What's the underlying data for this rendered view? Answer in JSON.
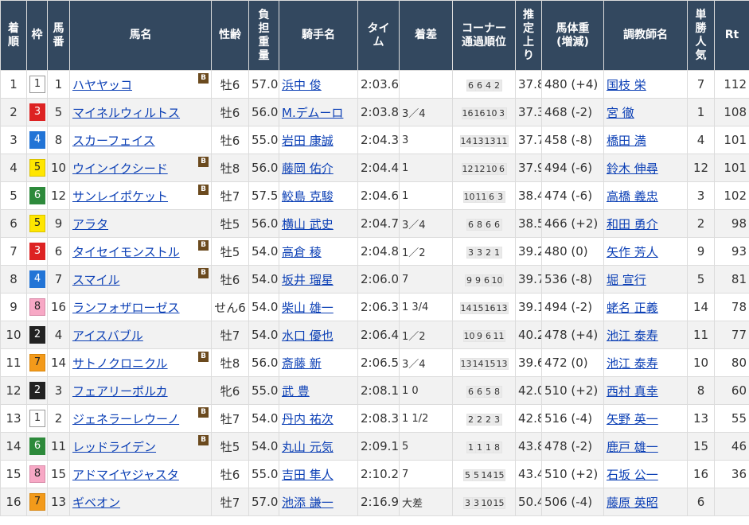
{
  "headers": [
    "着\n順",
    "枠",
    "馬\n番",
    "馬名",
    "性齢",
    "負\n担\n重\n量",
    "騎手名",
    "タイ\nム",
    "着差",
    "コーナー\n通過順位",
    "推\n定\n上\nり",
    "馬体重\n(増減)",
    "調教師名",
    "単\n勝\n人\n気",
    "Rt"
  ],
  "blinker_label": "B",
  "rows": [
    {
      "rank": "1",
      "waku": "1",
      "ban": "1",
      "horse": "ハヤヤッコ",
      "b": true,
      "sex_age": "牡6",
      "weight": "57.0",
      "jockey": "浜中 俊",
      "time": "2:03.6",
      "margin": "",
      "corners": [
        "6",
        "6",
        "4",
        "2"
      ],
      "last3f": "37.8",
      "body": "480 (+4)",
      "trainer": "国枝 栄",
      "pop": "7",
      "rt": "112"
    },
    {
      "rank": "2",
      "waku": "3",
      "ban": "5",
      "horse": "マイネルウィルトス",
      "b": false,
      "sex_age": "牡6",
      "weight": "56.0",
      "jockey": "M.デムーロ",
      "time": "2:03.8",
      "margin": "3／4",
      "corners": [
        "16",
        "16",
        "10",
        "3"
      ],
      "last3f": "37.3",
      "body": "468 (-2)",
      "trainer": "宮 徹",
      "pop": "1",
      "rt": "108"
    },
    {
      "rank": "3",
      "waku": "4",
      "ban": "8",
      "horse": "スカーフェイス",
      "b": false,
      "sex_age": "牡6",
      "weight": "55.0",
      "jockey": "岩田 康誠",
      "time": "2:04.3",
      "margin": "3",
      "corners": [
        "14",
        "13",
        "13",
        "11"
      ],
      "last3f": "37.7",
      "body": "458 (-8)",
      "trainer": "橋田 満",
      "pop": "4",
      "rt": "101"
    },
    {
      "rank": "4",
      "waku": "5",
      "ban": "10",
      "horse": "ウインイクシード",
      "b": true,
      "sex_age": "牡8",
      "weight": "56.0",
      "jockey": "藤岡 佑介",
      "time": "2:04.4",
      "margin": "1",
      "corners": [
        "12",
        "12",
        "10",
        "6"
      ],
      "last3f": "37.9",
      "body": "494 (-6)",
      "trainer": "鈴木 伸尋",
      "pop": "12",
      "rt": "101"
    },
    {
      "rank": "5",
      "waku": "6",
      "ban": "12",
      "horse": "サンレイポケット",
      "b": true,
      "sex_age": "牡7",
      "weight": "57.5",
      "jockey": "鮫島 克駿",
      "time": "2:04.6",
      "margin": "1",
      "corners": [
        "10",
        "11",
        "6",
        "3"
      ],
      "last3f": "38.4",
      "body": "474 (-6)",
      "trainer": "高橋 義忠",
      "pop": "3",
      "rt": "102"
    },
    {
      "rank": "6",
      "waku": "5",
      "ban": "9",
      "horse": "アラタ",
      "b": false,
      "sex_age": "牡5",
      "weight": "56.0",
      "jockey": "横山 武史",
      "time": "2:04.7",
      "margin": "3／4",
      "corners": [
        "6",
        "8",
        "6",
        "6"
      ],
      "last3f": "38.5",
      "body": "466 (+2)",
      "trainer": "和田 勇介",
      "pop": "2",
      "rt": "98"
    },
    {
      "rank": "7",
      "waku": "3",
      "ban": "6",
      "horse": "タイセイモンストル",
      "b": true,
      "sex_age": "牡5",
      "weight": "54.0",
      "jockey": "高倉 稜",
      "time": "2:04.8",
      "margin": "1／2",
      "corners": [
        "3",
        "3",
        "2",
        "1"
      ],
      "last3f": "39.2",
      "body": "480 (0)",
      "trainer": "矢作 芳人",
      "pop": "9",
      "rt": "93"
    },
    {
      "rank": "8",
      "waku": "4",
      "ban": "7",
      "horse": "スマイル",
      "b": true,
      "sex_age": "牡6",
      "weight": "54.0",
      "jockey": "坂井 瑠星",
      "time": "2:06.0",
      "margin": "7",
      "corners": [
        "9",
        "9",
        "6",
        "10"
      ],
      "last3f": "39.7",
      "body": "536 (-8)",
      "trainer": "堀 宣行",
      "pop": "5",
      "rt": "81"
    },
    {
      "rank": "9",
      "waku": "8",
      "ban": "16",
      "horse": "ランフォザローゼス",
      "b": false,
      "sex_age": "せん6",
      "weight": "54.0",
      "jockey": "柴山 雄一",
      "time": "2:06.3",
      "margin": "1 3/4",
      "corners": [
        "14",
        "15",
        "16",
        "13"
      ],
      "last3f": "39.1",
      "body": "494 (-2)",
      "trainer": "蛯名 正義",
      "pop": "14",
      "rt": "78"
    },
    {
      "rank": "10",
      "waku": "2",
      "ban": "4",
      "horse": "アイスバブル",
      "b": false,
      "sex_age": "牡7",
      "weight": "54.0",
      "jockey": "水口 優也",
      "time": "2:06.4",
      "margin": "1／2",
      "corners": [
        "10",
        "9",
        "6",
        "11"
      ],
      "last3f": "40.2",
      "body": "478 (+4)",
      "trainer": "池江 泰寿",
      "pop": "11",
      "rt": "77"
    },
    {
      "rank": "11",
      "waku": "7",
      "ban": "14",
      "horse": "サトノクロニクル",
      "b": true,
      "sex_age": "牡8",
      "weight": "56.0",
      "jockey": "斎藤 新",
      "time": "2:06.5",
      "margin": "3／4",
      "corners": [
        "13",
        "14",
        "15",
        "13"
      ],
      "last3f": "39.6",
      "body": "472 (0)",
      "trainer": "池江 泰寿",
      "pop": "10",
      "rt": "80"
    },
    {
      "rank": "12",
      "waku": "2",
      "ban": "3",
      "horse": "フェアリーポルカ",
      "b": false,
      "sex_age": "牝6",
      "weight": "55.0",
      "jockey": "武 豊",
      "time": "2:08.1",
      "margin": "1 0",
      "corners": [
        "6",
        "6",
        "5",
        "8"
      ],
      "last3f": "42.0",
      "body": "510 (+2)",
      "trainer": "西村 真幸",
      "pop": "8",
      "rt": "60"
    },
    {
      "rank": "13",
      "waku": "1",
      "ban": "2",
      "horse": "ジェネラーレウーノ",
      "b": true,
      "sex_age": "牡7",
      "weight": "54.0",
      "jockey": "丹内 祐次",
      "time": "2:08.3",
      "margin": "1 1/2",
      "corners": [
        "2",
        "2",
        "2",
        "3"
      ],
      "last3f": "42.8",
      "body": "516 (-4)",
      "trainer": "矢野 英一",
      "pop": "13",
      "rt": "55"
    },
    {
      "rank": "14",
      "waku": "6",
      "ban": "11",
      "horse": "レッドライデン",
      "b": true,
      "sex_age": "牡5",
      "weight": "54.0",
      "jockey": "丸山 元気",
      "time": "2:09.1",
      "margin": "5",
      "corners": [
        "1",
        "1",
        "1",
        "8"
      ],
      "last3f": "43.8",
      "body": "478 (-2)",
      "trainer": "鹿戸 雄一",
      "pop": "15",
      "rt": "46"
    },
    {
      "rank": "15",
      "waku": "8",
      "ban": "15",
      "horse": "アドマイヤジャスタ",
      "b": false,
      "sex_age": "牡6",
      "weight": "55.0",
      "jockey": "吉田 隼人",
      "time": "2:10.2",
      "margin": "7",
      "corners": [
        "5",
        "5",
        "14",
        "15"
      ],
      "last3f": "43.4",
      "body": "510 (+2)",
      "trainer": "石坂 公一",
      "pop": "16",
      "rt": "36"
    },
    {
      "rank": "16",
      "waku": "7",
      "ban": "13",
      "horse": "ギベオン",
      "b": false,
      "sex_age": "牡7",
      "weight": "57.0",
      "jockey": "池添 謙一",
      "time": "2:16.9",
      "margin": "大差",
      "corners": [
        "3",
        "3",
        "10",
        "15"
      ],
      "last3f": "50.4",
      "body": "506 (-4)",
      "trainer": "藤原 英昭",
      "pop": "6",
      "rt": ""
    }
  ]
}
